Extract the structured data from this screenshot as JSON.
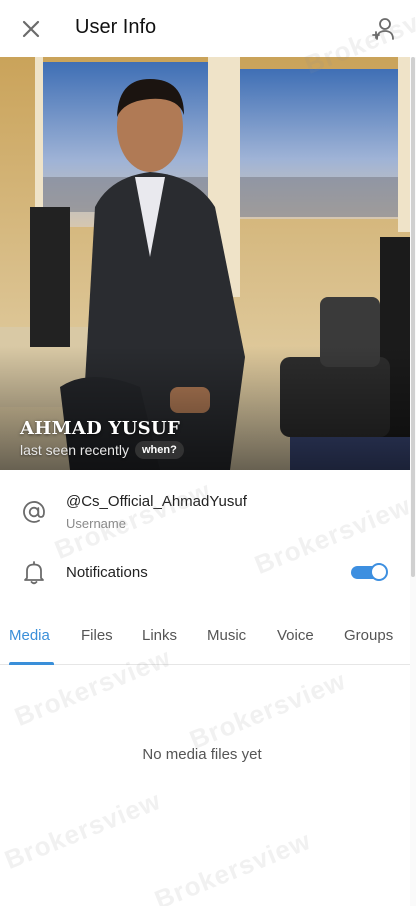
{
  "header": {
    "title": "User Info",
    "close_icon": "close-icon",
    "add_contact_icon": "add-contact-icon"
  },
  "profile": {
    "name": "AHMAD YUSUF",
    "status": "last seen recently",
    "when_badge": "when?"
  },
  "info": {
    "username_value": "@Cs_Official_AhmadYusuf",
    "username_label": "Username",
    "notifications_label": "Notifications",
    "notifications_enabled": true
  },
  "tabs": [
    {
      "label": "Media",
      "active": true
    },
    {
      "label": "Files",
      "active": false
    },
    {
      "label": "Links",
      "active": false
    },
    {
      "label": "Music",
      "active": false
    },
    {
      "label": "Voice",
      "active": false
    },
    {
      "label": "Groups",
      "active": false
    }
  ],
  "empty_state": "No media files yet",
  "watermark": "Brokersview",
  "colors": {
    "accent": "#3a8fd9",
    "toggle": "#3d8fe0"
  }
}
